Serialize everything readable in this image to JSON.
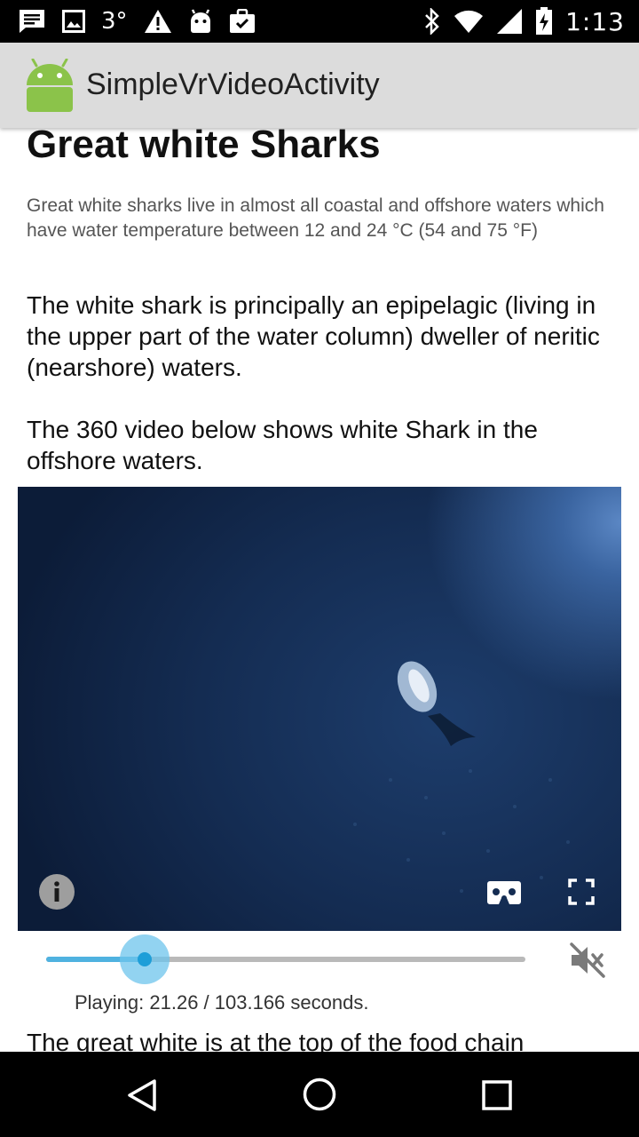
{
  "status_bar": {
    "temperature": "3°",
    "time": "1:13",
    "icons": [
      "message-icon",
      "image-icon",
      "warning-icon",
      "android-icon",
      "clipboard-check-icon",
      "bluetooth-icon",
      "wifi-icon",
      "cell-signal-icon",
      "battery-charging-icon"
    ]
  },
  "app_bar": {
    "title": "SimpleVrVideoActivity"
  },
  "article": {
    "heading": "Great white Sharks",
    "intro": "Great white sharks live in almost all coastal and offshore waters which have water temperature between 12 and 24 °C (54 and 75 °F)",
    "paragraph1": "The white shark is principally an epipelagic (living in the upper part of the water column) dweller of neritic (nearshore) waters.",
    "paragraph2": "The 360 video below shows white Shark in the offshore waters.",
    "paragraph3": "The great white is at the top of the food chain"
  },
  "video": {
    "info_icon": "info-icon",
    "cardboard_icon": "vr-cardboard-icon",
    "fullscreen_icon": "fullscreen-icon",
    "progress_fraction": 0.206,
    "status_text": "Playing: 21.26 / 103.166 seconds."
  },
  "colors": {
    "accent": "#4fb2e0",
    "app_bar": "#dcdcdc"
  },
  "nav_bar": {
    "icons": [
      "back-icon",
      "home-icon",
      "recents-icon"
    ]
  }
}
